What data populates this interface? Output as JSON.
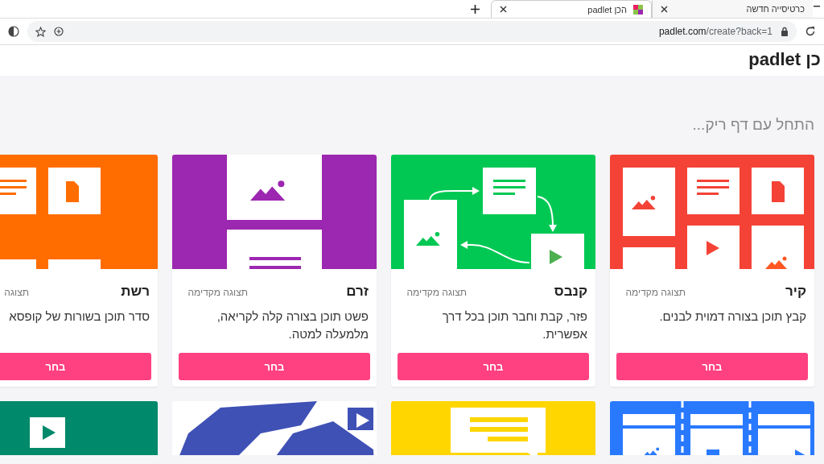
{
  "browser": {
    "tabs": [
      {
        "title": "כרטיסייה חדשה",
        "selected": false
      },
      {
        "title": "הכן padlet",
        "selected": true
      }
    ],
    "url_host": "padlet.com",
    "url_path": "/create?back=1"
  },
  "page": {
    "heading": "כן padlet",
    "section_title": "התחל עם דף ריק...",
    "templates": [
      {
        "kind": "wall",
        "color": "#f44336",
        "title": "קיר",
        "preview": "תצוגה מקדימה",
        "description": "קבץ תוכן בצורה דמוית לבנים.",
        "button": "בחר"
      },
      {
        "kind": "canvas",
        "color": "#00c853",
        "title": "קנבס",
        "preview": "תצוגה מקדימה",
        "description": "פזר, קבת וחבר תוכן בכל דרך אפשרית.",
        "button": "בחר"
      },
      {
        "kind": "stream",
        "color": "#9c27b0",
        "title": "זרם",
        "preview": "תצוגה מקדימה",
        "description": "פשט תוכן בצורה קלה לקריאה, מלמעלה למטה.",
        "button": "בחר"
      },
      {
        "kind": "grid",
        "color": "#ff6d00",
        "title": "רשת",
        "preview": "תצוגה",
        "description": "סדר תוכן בשורות של קופסא",
        "button": "בחר"
      }
    ],
    "more_templates": [
      {
        "kind": "timeline",
        "color": "#2979ff"
      },
      {
        "kind": "backchannel",
        "color": "#ffd600"
      },
      {
        "kind": "map",
        "color": "#3f51b5"
      },
      {
        "kind": "shelf",
        "color": "#00896b"
      }
    ]
  }
}
